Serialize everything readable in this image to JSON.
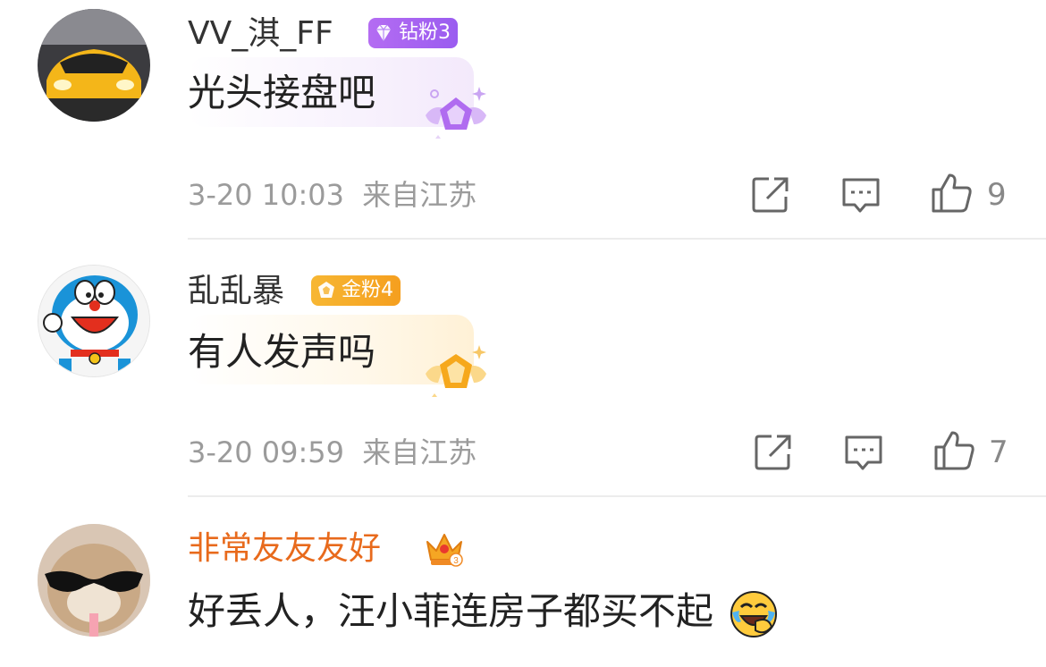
{
  "comments": [
    {
      "username": "VV_淇_FF",
      "badge": {
        "label": "钻粉3",
        "icon": "diamond-icon",
        "color": "#a862f2"
      },
      "text": "光头接盘吧",
      "time": "3-20 10:03",
      "location": "来自江苏",
      "likes": "9",
      "avatar": "yellow-sports-car"
    },
    {
      "username": "乱乱暴",
      "badge": {
        "label": "金粉4",
        "icon": "gold-gem-icon",
        "color": "#f5a623"
      },
      "text": "有人发声吗",
      "time": "3-20 09:59",
      "location": "来自江苏",
      "likes": "7",
      "avatar": "doraemon"
    },
    {
      "username": "非常友友友好",
      "username_color": "#e86a1c",
      "badge": {
        "label": "",
        "icon": "crown-icon"
      },
      "text": "好丢人，汪小菲连房子都买不起",
      "emoji": "laughing-crying-emoji",
      "avatar": "cat-with-sunglasses"
    }
  ],
  "actions": {
    "share_icon": "share-icon",
    "comment_icon": "comment-icon",
    "like_icon": "thumbs-up-icon"
  }
}
